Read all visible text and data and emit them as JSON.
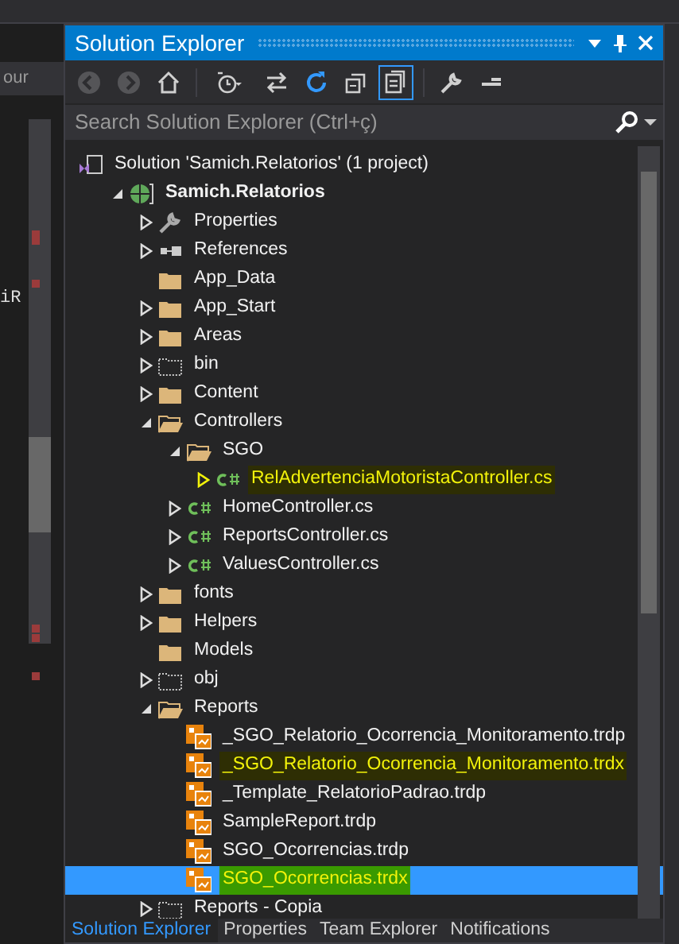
{
  "left_pane": {
    "dropdown_text": "our",
    "code_fragment": "iR"
  },
  "panel": {
    "title": "Solution Explorer",
    "toolbar": [
      {
        "kind": "back",
        "disabled": true
      },
      {
        "kind": "forward",
        "disabled": true
      },
      {
        "kind": "home",
        "disabled": false
      },
      {
        "kind": "sep"
      },
      {
        "kind": "history",
        "disabled": false
      },
      {
        "kind": "sync",
        "disabled": false
      },
      {
        "kind": "refresh",
        "disabled": false
      },
      {
        "kind": "collapse",
        "disabled": false
      },
      {
        "kind": "showall",
        "disabled": false,
        "selected": true
      },
      {
        "kind": "sep"
      },
      {
        "kind": "properties",
        "disabled": false
      },
      {
        "kind": "pending",
        "disabled": false
      }
    ],
    "search": {
      "placeholder": "Search Solution Explorer (Ctrl+ç)"
    },
    "tree": [
      {
        "label": "Solution 'Samich.Relatorios' (1 project)",
        "kind": "solution",
        "selected": false,
        "highlighted": false,
        "children": [
          {
            "label": "Samich.Relatorios",
            "kind": "project",
            "expanded": true,
            "selected": false,
            "highlighted": false,
            "children": [
              {
                "label": "Properties",
                "kind": "wrench",
                "expanded": false,
                "selected": false,
                "highlighted": false
              },
              {
                "label": "References",
                "kind": "references",
                "expanded": false,
                "selected": false,
                "highlighted": false
              },
              {
                "label": "App_Data",
                "kind": "folder",
                "selected": false,
                "highlighted": false
              },
              {
                "label": "App_Start",
                "kind": "folder",
                "expanded": false,
                "selected": false,
                "highlighted": false
              },
              {
                "label": "Areas",
                "kind": "folder",
                "expanded": false,
                "selected": false,
                "highlighted": false
              },
              {
                "label": "bin",
                "kind": "hidden-folder",
                "expanded": false,
                "selected": false,
                "highlighted": false
              },
              {
                "label": "Content",
                "kind": "folder",
                "expanded": false,
                "selected": false,
                "highlighted": false
              },
              {
                "label": "Controllers",
                "kind": "folder",
                "expanded": true,
                "selected": false,
                "highlighted": false,
                "children": [
                  {
                    "label": "SGO",
                    "kind": "folder",
                    "expanded": true,
                    "selected": false,
                    "highlighted": false,
                    "children": [
                      {
                        "label": "RelAdvertenciaMotoristaController.cs",
                        "kind": "csharp",
                        "expanded": false,
                        "selected": false,
                        "highlighted": true
                      }
                    ]
                  },
                  {
                    "label": "HomeController.cs",
                    "kind": "csharp",
                    "expanded": false,
                    "selected": false,
                    "highlighted": false
                  },
                  {
                    "label": "ReportsController.cs",
                    "kind": "csharp",
                    "expanded": false,
                    "selected": false,
                    "highlighted": false
                  },
                  {
                    "label": "ValuesController.cs",
                    "kind": "csharp",
                    "expanded": false,
                    "selected": false,
                    "highlighted": false
                  }
                ]
              },
              {
                "label": "fonts",
                "kind": "folder",
                "expanded": false,
                "selected": false,
                "highlighted": false
              },
              {
                "label": "Helpers",
                "kind": "folder",
                "expanded": false,
                "selected": false,
                "highlighted": false
              },
              {
                "label": "Models",
                "kind": "folder",
                "selected": false,
                "highlighted": false
              },
              {
                "label": "obj",
                "kind": "hidden-folder",
                "expanded": false,
                "selected": false,
                "highlighted": false
              },
              {
                "label": "Reports",
                "kind": "folder",
                "expanded": true,
                "selected": false,
                "highlighted": false,
                "children": [
                  {
                    "label": "_SGO_Relatorio_Ocorrencia_Monitoramento.trdp",
                    "kind": "report",
                    "selected": false,
                    "highlighted": false
                  },
                  {
                    "label": "_SGO_Relatorio_Ocorrencia_Monitoramento.trdx",
                    "kind": "report",
                    "selected": false,
                    "highlighted": true
                  },
                  {
                    "label": "_Template_RelatorioPadrao.trdp",
                    "kind": "report",
                    "selected": false,
                    "highlighted": false
                  },
                  {
                    "label": "SampleReport.trdp",
                    "kind": "report",
                    "selected": false,
                    "highlighted": false
                  },
                  {
                    "label": "SGO_Ocorrencias.trdp",
                    "kind": "report",
                    "selected": false,
                    "highlighted": false
                  },
                  {
                    "label": "SGO_Ocorrencias.trdx",
                    "kind": "report",
                    "selected": true,
                    "highlighted": true
                  }
                ]
              },
              {
                "label": "Reports - Copia",
                "kind": "hidden-folder",
                "expanded": false,
                "selected": false,
                "highlighted": false
              }
            ]
          }
        ]
      }
    ]
  },
  "bottom_tabs": [
    {
      "label": "Solution Explorer",
      "selected": true
    },
    {
      "label": "Properties",
      "selected": false
    },
    {
      "label": "Team Explorer",
      "selected": false
    },
    {
      "label": "Notifications",
      "selected": false
    }
  ]
}
